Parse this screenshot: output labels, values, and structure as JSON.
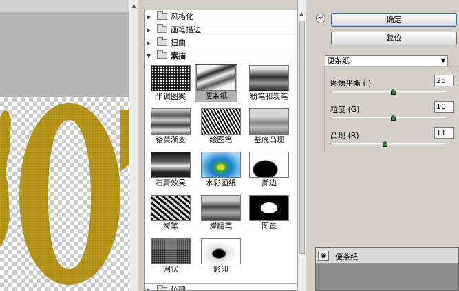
{
  "categories": [
    {
      "label": "风格化",
      "open": false
    },
    {
      "label": "画笔描边",
      "open": false
    },
    {
      "label": "扭曲",
      "open": false
    },
    {
      "label": "素描",
      "open": true
    }
  ],
  "bottom_category": {
    "label": "纹理"
  },
  "thumbnails": [
    {
      "label": "半调图案"
    },
    {
      "label": "便条纸",
      "selected": true
    },
    {
      "label": "粉笔和炭笔"
    },
    {
      "label": "铬黄渐变"
    },
    {
      "label": "绘图笔"
    },
    {
      "label": "基底凸现"
    },
    {
      "label": "石膏效果"
    },
    {
      "label": "水彩画纸"
    },
    {
      "label": "撕边"
    },
    {
      "label": "炭笔"
    },
    {
      "label": "炭精笔"
    },
    {
      "label": "图章"
    },
    {
      "label": "网状"
    },
    {
      "label": "影印"
    }
  ],
  "buttons": {
    "ok": "确定",
    "reset": "复位"
  },
  "filter_select": {
    "value": "便条纸"
  },
  "params": [
    {
      "label": "图像平衡 (I)",
      "value": "25",
      "fraction": 0.54
    },
    {
      "label": "粒度 (G)",
      "value": "10",
      "fraction": 0.54
    },
    {
      "label": "凸现 (R)",
      "value": "11",
      "fraction": 0.47
    }
  ],
  "layer": {
    "name": "便条纸"
  },
  "colors": {
    "gold": "#b79a18",
    "accent_knob": "#2c8a2c"
  }
}
